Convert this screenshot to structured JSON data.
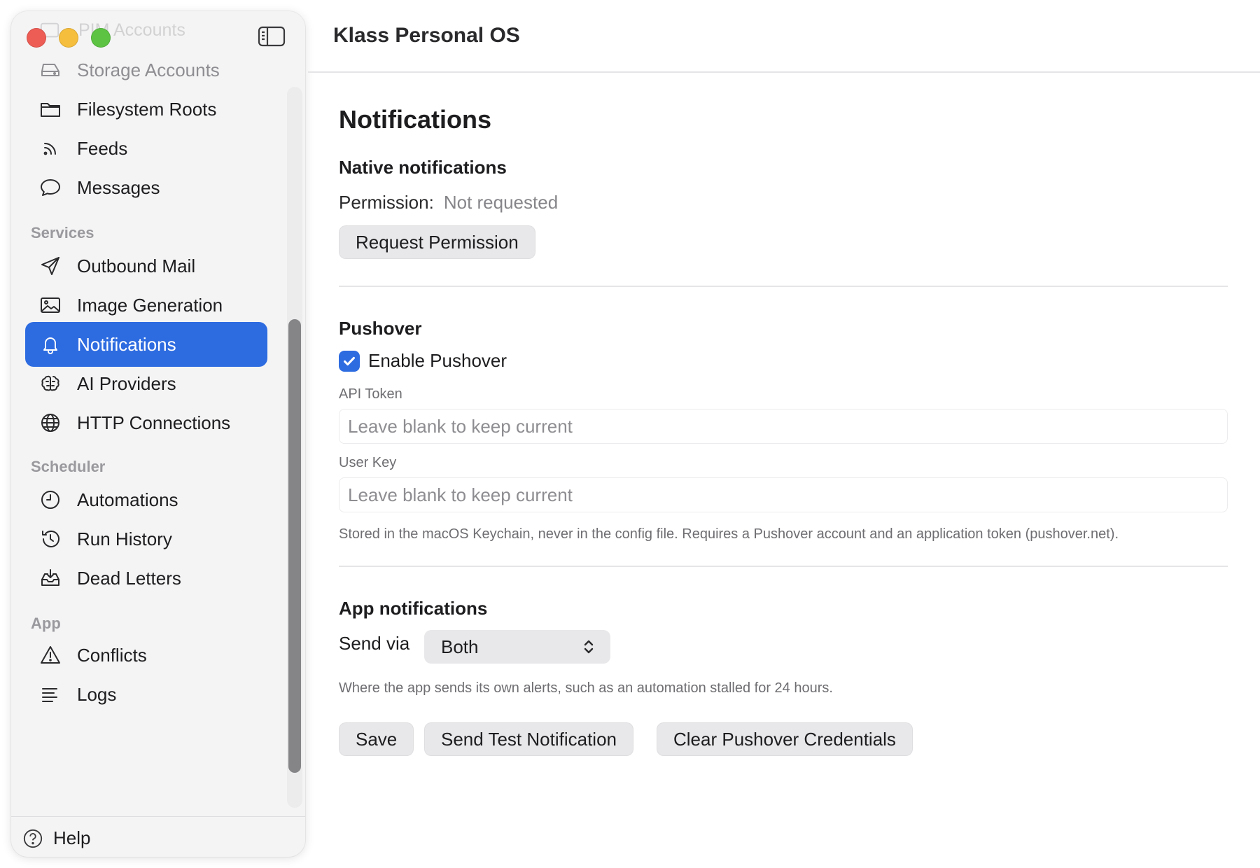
{
  "window": {
    "title": "Klass Personal OS"
  },
  "sidebar": {
    "faded_top_item": "PIM Accounts",
    "items": [
      {
        "label": "Storage Accounts",
        "icon": "hard-drive-icon"
      },
      {
        "label": "Filesystem Roots",
        "icon": "folder-icon"
      },
      {
        "label": "Feeds",
        "icon": "rss-icon"
      },
      {
        "label": "Messages",
        "icon": "message-bubble-icon"
      },
      {
        "label": "Outbound Mail",
        "icon": "paper-plane-icon"
      },
      {
        "label": "Image Generation",
        "icon": "photo-icon"
      },
      {
        "label": "Notifications",
        "icon": "bell-icon"
      },
      {
        "label": "AI Providers",
        "icon": "brain-icon"
      },
      {
        "label": "HTTP Connections",
        "icon": "globe-icon"
      },
      {
        "label": "Automations",
        "icon": "clock-icon"
      },
      {
        "label": "Run History",
        "icon": "history-icon"
      },
      {
        "label": "Dead Letters",
        "icon": "tray-icon"
      },
      {
        "label": "Conflicts",
        "icon": "warning-triangle-icon"
      },
      {
        "label": "Logs",
        "icon": "lines-icon"
      }
    ],
    "sections": {
      "services": "Services",
      "scheduler": "Scheduler",
      "app": "App"
    },
    "active": "Notifications",
    "help": "Help"
  },
  "main": {
    "page_title": "Notifications",
    "native": {
      "heading": "Native notifications",
      "permission_label": "Permission:",
      "permission_value": "Not requested",
      "request_button": "Request Permission"
    },
    "pushover": {
      "heading": "Pushover",
      "enable_label": "Enable Pushover",
      "enabled": true,
      "api_token_label": "API Token",
      "api_token_placeholder": "Leave blank to keep current",
      "user_key_label": "User Key",
      "user_key_placeholder": "Leave blank to keep current",
      "hint": "Stored in the macOS Keychain, never in the config file. Requires a Pushover account and an application token (pushover.net)."
    },
    "app_notifications": {
      "heading": "App notifications",
      "send_via_label": "Send via",
      "send_via_value": "Both",
      "hint": "Where the app sends its own alerts, such as an automation stalled for 24 hours."
    },
    "buttons": {
      "save": "Save",
      "send_test": "Send Test Notification",
      "clear_pushover": "Clear Pushover Credentials"
    }
  },
  "colors": {
    "accent": "#2d6be0",
    "sidebar_bg": "#f4f4f5",
    "button_bg": "#e8e8ea"
  }
}
